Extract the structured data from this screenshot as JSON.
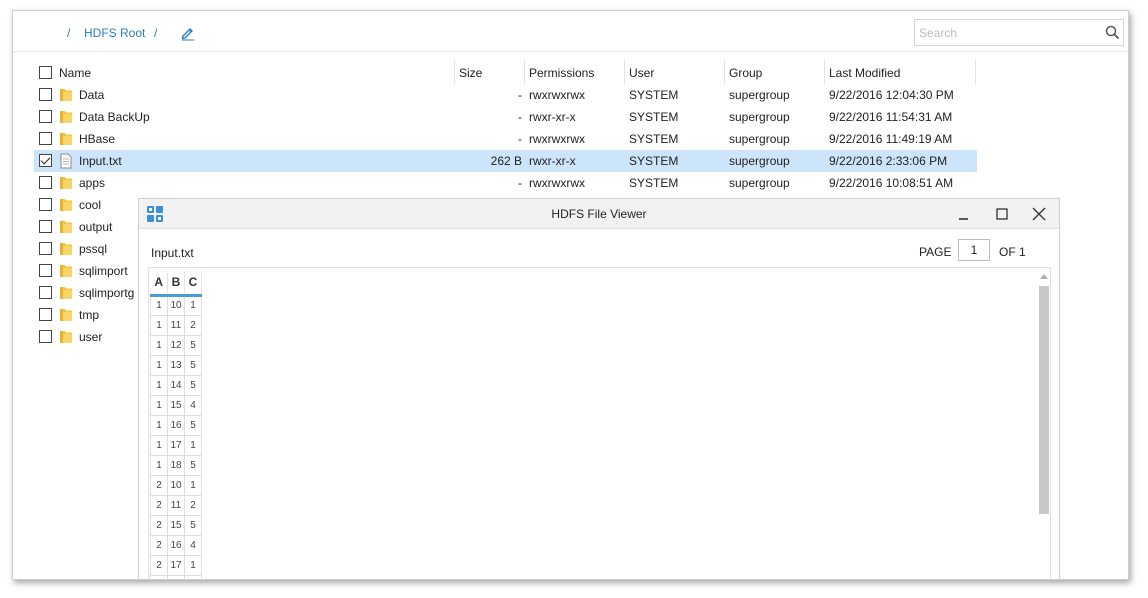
{
  "breadcrumb": {
    "sep1": "/",
    "root": "HDFS Root",
    "sep2": "/"
  },
  "search": {
    "placeholder": "Search"
  },
  "columns": {
    "name": "Name",
    "size": "Size",
    "permissions": "Permissions",
    "user": "User",
    "group": "Group",
    "modified": "Last Modified"
  },
  "files": [
    {
      "name": "Data",
      "type": "folder",
      "size": "-",
      "permissions": "rwxrwxrwx",
      "user": "SYSTEM",
      "group": "supergroup",
      "modified": "9/22/2016 12:04:30 PM",
      "checked": false
    },
    {
      "name": "Data BackUp",
      "type": "folder",
      "size": "-",
      "permissions": "rwxr-xr-x",
      "user": "SYSTEM",
      "group": "supergroup",
      "modified": "9/22/2016 11:54:31 AM",
      "checked": false
    },
    {
      "name": "HBase",
      "type": "folder",
      "size": "-",
      "permissions": "rwxrwxrwx",
      "user": "SYSTEM",
      "group": "supergroup",
      "modified": "9/22/2016 11:49:19 AM",
      "checked": false
    },
    {
      "name": "Input.txt",
      "type": "file",
      "size": "262 B",
      "permissions": "rwxr-xr-x",
      "user": "SYSTEM",
      "group": "supergroup",
      "modified": "9/22/2016 2:33:06 PM",
      "checked": true
    },
    {
      "name": "apps",
      "type": "folder",
      "size": "-",
      "permissions": "rwxrwxrwx",
      "user": "SYSTEM",
      "group": "supergroup",
      "modified": "9/22/2016 10:08:51 AM",
      "checked": false
    },
    {
      "name": "cool",
      "type": "folder",
      "size": "",
      "permissions": "",
      "user": "",
      "group": "",
      "modified": "",
      "checked": false
    },
    {
      "name": "output",
      "type": "folder",
      "size": "",
      "permissions": "",
      "user": "",
      "group": "",
      "modified": "",
      "checked": false
    },
    {
      "name": "pssql",
      "type": "folder",
      "size": "",
      "permissions": "",
      "user": "",
      "group": "",
      "modified": "",
      "checked": false
    },
    {
      "name": "sqlimport",
      "type": "folder",
      "size": "",
      "permissions": "",
      "user": "",
      "group": "",
      "modified": "",
      "checked": false
    },
    {
      "name": "sqlimportg",
      "type": "folder",
      "size": "",
      "permissions": "",
      "user": "",
      "group": "",
      "modified": "",
      "checked": false
    },
    {
      "name": "tmp",
      "type": "folder",
      "size": "",
      "permissions": "",
      "user": "",
      "group": "",
      "modified": "",
      "checked": false
    },
    {
      "name": "user",
      "type": "folder",
      "size": "",
      "permissions": "",
      "user": "",
      "group": "",
      "modified": "",
      "checked": false
    }
  ],
  "viewer": {
    "title": "HDFS File Viewer",
    "filename": "Input.txt",
    "page_label": "PAGE",
    "page": "1",
    "of_label": "OF 1",
    "headers": [
      "A",
      "B",
      "C"
    ],
    "rows": [
      [
        "1",
        "10",
        "1"
      ],
      [
        "1",
        "11",
        "2"
      ],
      [
        "1",
        "12",
        "5"
      ],
      [
        "1",
        "13",
        "5"
      ],
      [
        "1",
        "14",
        "5"
      ],
      [
        "1",
        "15",
        "4"
      ],
      [
        "1",
        "16",
        "5"
      ],
      [
        "1",
        "17",
        "1"
      ],
      [
        "1",
        "18",
        "5"
      ],
      [
        "2",
        "10",
        "1"
      ],
      [
        "2",
        "11",
        "2"
      ],
      [
        "2",
        "15",
        "5"
      ],
      [
        "2",
        "16",
        "4"
      ],
      [
        "2",
        "17",
        "1"
      ],
      [
        "",
        "",
        ""
      ]
    ]
  },
  "colors": {
    "accent": "#2a7fc1",
    "selected_row": "#cce5fb",
    "folder": "#f5c542",
    "app_icon": "#3a8fd6"
  }
}
